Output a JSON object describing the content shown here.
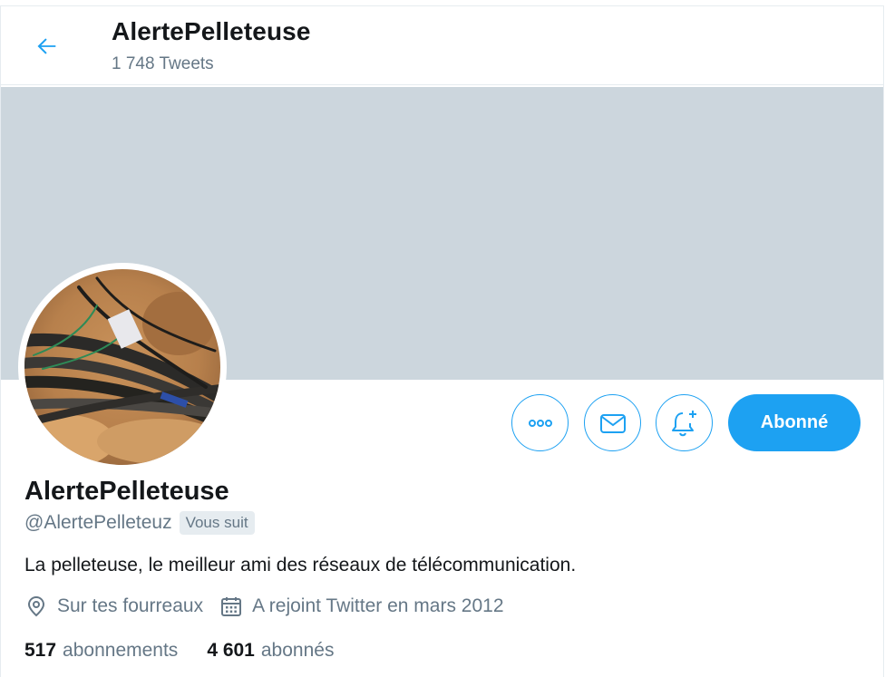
{
  "header": {
    "title": "AlertePelleteuse",
    "tweet_count": "1 748 Tweets"
  },
  "profile": {
    "name": "AlertePelleteuse",
    "handle": "@AlertePelleteuz",
    "follows_you": "Vous suit",
    "bio": "La pelleteuse, le meilleur ami des réseaux de télécommunication.",
    "location": "Sur tes fourreaux",
    "joined": "A rejoint Twitter en mars 2012"
  },
  "actions": {
    "follow_label": "Abonné"
  },
  "stats": {
    "following_count": "517",
    "following_label": "abonnements",
    "followers_count": "4 601",
    "followers_label": "abonnés"
  },
  "colors": {
    "accent": "#1da1f2",
    "banner": "#ccd6dd",
    "secondary_text": "#657786"
  }
}
